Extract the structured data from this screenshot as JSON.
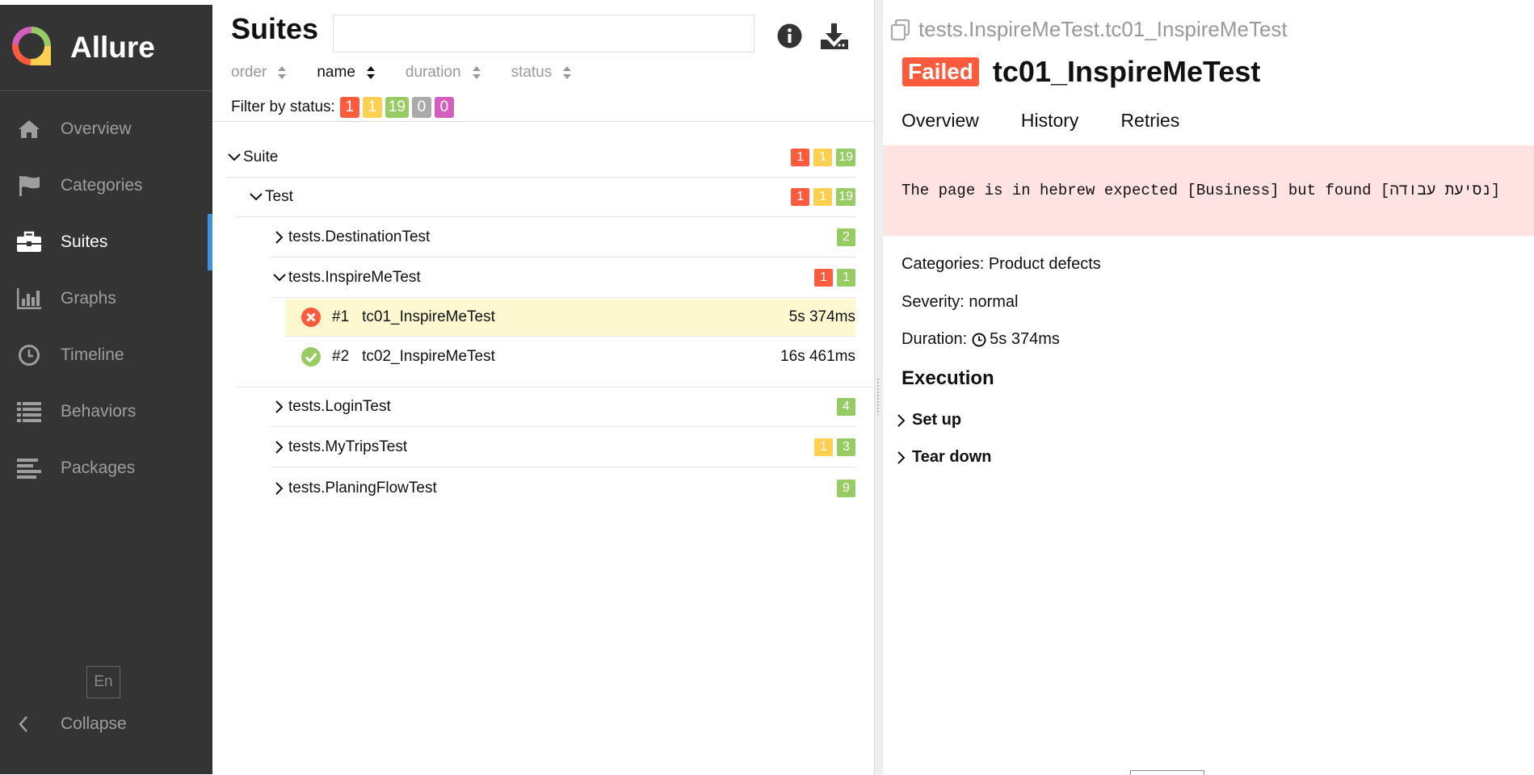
{
  "app": {
    "name": "Allure"
  },
  "sidebar": {
    "items": [
      {
        "label": "Overview",
        "icon": "home-icon"
      },
      {
        "label": "Categories",
        "icon": "flag-icon"
      },
      {
        "label": "Suites",
        "icon": "briefcase-icon",
        "active": true
      },
      {
        "label": "Graphs",
        "icon": "bar-chart-icon"
      },
      {
        "label": "Timeline",
        "icon": "clock-icon"
      },
      {
        "label": "Behaviors",
        "icon": "list-icon"
      },
      {
        "label": "Packages",
        "icon": "align-left-icon"
      }
    ],
    "language": "En",
    "collapse_label": "Collapse"
  },
  "suites_panel": {
    "title": "Suites",
    "search_value": "",
    "sort": [
      {
        "label": "order"
      },
      {
        "label": "name",
        "active": true
      },
      {
        "label": "duration"
      },
      {
        "label": "status"
      }
    ],
    "filter_label": "Filter by status:",
    "filter_counts": [
      "1",
      "1",
      "19",
      "0",
      "0"
    ],
    "tree": {
      "suite": {
        "label": "Suite",
        "counts": [
          "1",
          "1",
          "19"
        ]
      },
      "test": {
        "label": "Test",
        "counts": [
          "1",
          "1",
          "19"
        ]
      },
      "destination": {
        "label": "tests.DestinationTest",
        "counts": [
          "2"
        ]
      },
      "inspire": {
        "label": "tests.InspireMeTest",
        "counts": [
          "1",
          "1"
        ]
      },
      "cases": [
        {
          "num": "#1",
          "name": "tc01_InspireMeTest",
          "duration": "5s 374ms",
          "status": "failed"
        },
        {
          "num": "#2",
          "name": "tc02_InspireMeTest",
          "duration": "16s 461ms",
          "status": "passed"
        }
      ],
      "login": {
        "label": "tests.LoginTest",
        "counts": [
          "4"
        ]
      },
      "mytrips": {
        "label": "tests.MyTripsTest",
        "counts": [
          "1",
          "3"
        ]
      },
      "planing": {
        "label": "tests.PlaningFlowTest",
        "counts": [
          "9"
        ]
      }
    }
  },
  "detail": {
    "breadcrumb": "tests.InspireMeTest.tc01_InspireMeTest",
    "status_label": "Failed",
    "title": "tc01_InspireMeTest",
    "tabs": [
      "Overview",
      "History",
      "Retries"
    ],
    "error_message": "The page is in hebrew expected [Business] but found [נסיעת עבודה]",
    "categories": "Categories: Product defects",
    "severity": "Severity: normal",
    "duration_label": "Duration:",
    "duration_value": "5s 374ms",
    "execution_title": "Execution",
    "steps": [
      "Set up",
      "Tear down"
    ]
  },
  "colors": {
    "failed": "#fd5a3e",
    "broken": "#ffd050",
    "passed": "#97cc64",
    "skipped": "#aaaaaa",
    "unknown": "#d35ebe",
    "sidebar_bg": "#343434",
    "accent": "#3c92e0",
    "error_bg": "#ffe2e2",
    "selected_row": "#fef8d0"
  }
}
